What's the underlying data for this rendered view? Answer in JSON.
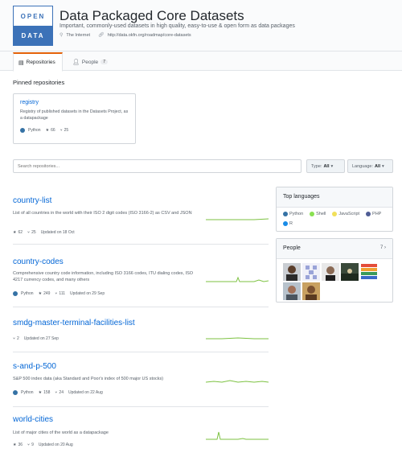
{
  "org": {
    "logo_top": "OPEN",
    "logo_bottom": "DATA",
    "title": "Data Packaged Core Datasets",
    "description": "Important, commonly-used datasets in high quality, easy-to-use & open form as data packages",
    "location": "The Internet",
    "url": "http://data.okfn.org/roadmap/core-datasets"
  },
  "tabs": {
    "repositories": "Repositories",
    "people": "People",
    "people_count": "7"
  },
  "pinned": {
    "heading": "Pinned repositories",
    "card": {
      "name": "registry",
      "description": "Registry of published datasets in the Datasets Project, as a datapackage",
      "language": "Python",
      "language_color": "#3572A5",
      "stars": "66",
      "forks": "25"
    }
  },
  "filters": {
    "search_placeholder": "Search repositories...",
    "type_label": "Type:",
    "type_value": "All",
    "language_label": "Language:",
    "language_value": "All"
  },
  "repos": [
    {
      "name": "country-list",
      "description": "List of all countries in the world with their ISO 2 digit codes (ISO 3166-2) as CSV and JSON",
      "language": "",
      "stars": "62",
      "forks": "25",
      "updated": "Updated on 18 Oct"
    },
    {
      "name": "country-codes",
      "description": "Comprehensive country code information, including ISO 3166 codes, ITU dialing codes, ISO 4217 currency codes, and many others",
      "language": "Python",
      "stars": "249",
      "forks": "111",
      "updated": "Updated on 29 Sep"
    },
    {
      "name": "smdg-master-terminal-facilities-list",
      "description": "",
      "language": "",
      "stars": "",
      "forks": "2",
      "updated": "Updated on 27 Sep"
    },
    {
      "name": "s-and-p-500",
      "description": "S&P 500 index data (aka Standard and Poor's index of 500 major US stocks)",
      "language": "Python",
      "stars": "158",
      "forks": "24",
      "updated": "Updated on 22 Aug"
    },
    {
      "name": "world-cities",
      "description": "List of major cities of the world as a datapackage",
      "language": "",
      "stars": "36",
      "forks": "9",
      "updated": "Updated on 20 Aug"
    }
  ],
  "sidebar": {
    "top_languages_title": "Top languages",
    "languages": [
      {
        "name": "Python",
        "color": "#3572A5"
      },
      {
        "name": "Shell",
        "color": "#89e051"
      },
      {
        "name": "JavaScript",
        "color": "#f1e05a"
      },
      {
        "name": "PHP",
        "color": "#4F5D95"
      },
      {
        "name": "R",
        "color": "#198CE7"
      }
    ],
    "people_title": "People",
    "people_count": "7"
  },
  "icons": {
    "location": "location-pin-icon",
    "link": "link-icon",
    "star": "star-icon",
    "fork": "fork-icon",
    "repo": "repo-icon",
    "person": "person-icon",
    "caret": "caret-down-icon",
    "chevron": "chevron-right-icon"
  },
  "colors": {
    "accent": "#e36209",
    "link": "#0366d6",
    "python": "#3572A5",
    "sparkline": "#7dc242",
    "brand": "#3c72b8"
  }
}
